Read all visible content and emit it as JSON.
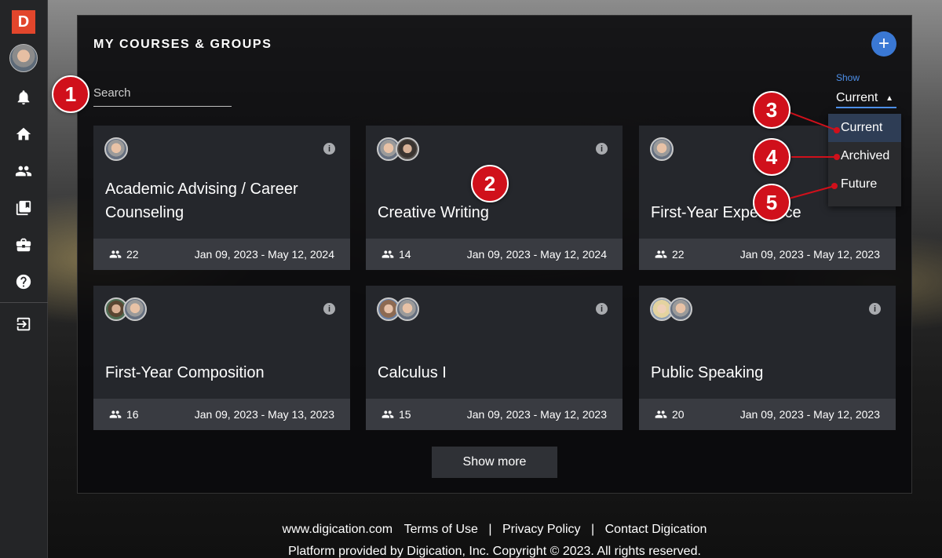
{
  "sidebar": {
    "logo": "D",
    "items": [
      {
        "name": "notifications",
        "icon": "bell-icon"
      },
      {
        "name": "home",
        "icon": "home-icon"
      },
      {
        "name": "people",
        "icon": "people-icon"
      },
      {
        "name": "library",
        "icon": "book-icon"
      },
      {
        "name": "portfolio",
        "icon": "briefcase-icon"
      },
      {
        "name": "help",
        "icon": "help-icon"
      },
      {
        "name": "logout",
        "icon": "logout-icon"
      }
    ]
  },
  "header": {
    "title": "MY COURSES & GROUPS",
    "add_label": "+"
  },
  "search": {
    "placeholder": "Search"
  },
  "filter": {
    "label": "Show",
    "value": "Current",
    "options": [
      "Current",
      "Archived",
      "Future"
    ]
  },
  "courses": [
    {
      "title": "Academic Advising / Career Counseling",
      "members": "22",
      "dates": "Jan 09, 2023 - May 12, 2024"
    },
    {
      "title": "Creative Writing",
      "members": "14",
      "dates": "Jan 09, 2023 - May 12, 2024"
    },
    {
      "title": "First-Year Experience",
      "members": "22",
      "dates": "Jan 09, 2023 - May 12, 2023"
    },
    {
      "title": "First-Year Composition",
      "members": "16",
      "dates": "Jan 09, 2023 - May 13, 2023"
    },
    {
      "title": "Calculus I",
      "members": "15",
      "dates": "Jan 09, 2023 - May 12, 2023"
    },
    {
      "title": "Public Speaking",
      "members": "20",
      "dates": "Jan 09, 2023 - May 12, 2023"
    }
  ],
  "show_more": "Show more",
  "callouts": [
    "1",
    "2",
    "3",
    "4",
    "5"
  ],
  "footer": {
    "site": "www.digication.com",
    "terms": "Terms of Use",
    "privacy": "Privacy Policy",
    "contact": "Contact Digication",
    "separator": "|",
    "copyright": "Platform provided by Digication, Inc. Copyright © 2023. All rights reserved."
  },
  "colors": {
    "accent": "#3a78d4",
    "logo": "#e2462c",
    "callout": "#d0101b",
    "card": "#25272c",
    "card_footer": "#393b41"
  }
}
